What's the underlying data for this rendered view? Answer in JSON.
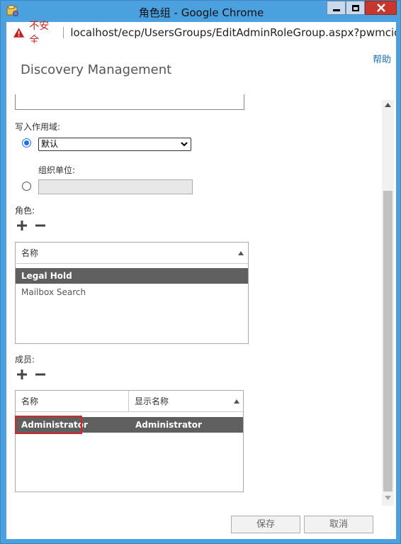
{
  "window": {
    "title": "角色组 - Google Chrome",
    "accent_color": "#4ba0df",
    "close_color": "#c7372c"
  },
  "addressbar": {
    "security_label": "不安全",
    "url": "localhost/ecp/UsersGroups/EditAdminRoleGroup.aspx?pwmcid..."
  },
  "header": {
    "help_label": "帮助",
    "title": "Discovery Management"
  },
  "form": {
    "write_scope_label": "写入作用域:",
    "scope_select_value": "默认",
    "org_unit_label": "组织单位:",
    "roles_label": "角色:",
    "members_label": "成员:"
  },
  "roles_table": {
    "columns": [
      "名称"
    ],
    "rows": [
      {
        "name": "Legal Hold",
        "selected": true
      },
      {
        "name": "Mailbox Search",
        "selected": false
      }
    ]
  },
  "members_table": {
    "columns": [
      "名称",
      "显示名称"
    ],
    "rows": [
      {
        "name": "Administrator",
        "display_name": "Administrator",
        "selected": true
      }
    ]
  },
  "footer": {
    "save_label": "保存",
    "cancel_label": "取消"
  },
  "icons": {
    "app": "ecp-app-icon",
    "warning": "warning-triangle-icon",
    "add": "plus-icon",
    "remove": "minus-icon",
    "sort": "sort-ascending-icon",
    "select_arrow": "chevron-down-icon"
  }
}
